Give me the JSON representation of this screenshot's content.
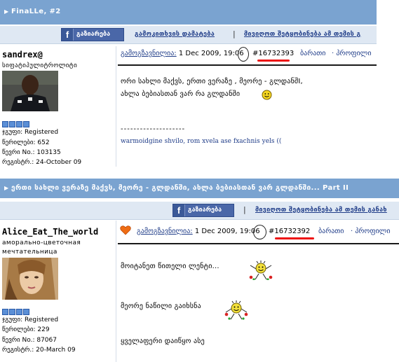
{
  "post1": {
    "thread_title": "FinaLLe, #2",
    "share_label": "გაზიარება",
    "add_link": "გამოკითხვის დამატება",
    "subscribe_link": "მივიღოთ შეტყობინება ამ თემის გ",
    "username": "sandrex@",
    "user_title": "სიფატიპულიტროლიტი",
    "group_label": "ჯგუფი: Registered",
    "posts_label": "წერილები: 652",
    "member_no": "წევრი No.: 103135",
    "registered": "რეგისტრ.: 24-October 09",
    "post_type": "გამოგზავნილია:",
    "date": "1 Dec 2009, 19:06",
    "post_id": "#16732393",
    "reply_link": "ბარათი",
    "profile_link": "· პროფილი",
    "message_line1": "ორი სახლი მაქვს, ერთი ვერაზე , მეორე - გლდანშI,",
    "message_line2": "ახლა ბებიასთან ვარ რა გლდანში",
    "separator": "--------------------",
    "signature": "warmoidgine shvilo, rom xvela ase fxachnis yels (("
  },
  "post2": {
    "thread_title": "ერთი სახლი ვერაზე მაქვს, მეორე - გლდანში, ახლა ბებიასთან ვარ გლდანში... Part II",
    "share_label": "გაზიარება",
    "subscribe_link": "მივიღოთ შეტყობინება ამ თემის განახ",
    "username": "Alice_Eat_The_world",
    "user_title_line1": "аморально-цветочная",
    "user_title_line2": "мечтательница",
    "group_label": "ჯგუფი: Registered",
    "posts_label": "წერილები: 229",
    "member_no": "წევრი No.: 87067",
    "registered": "რეგისტრ.: 20-March 09",
    "post_type": "გამოგზავნილია:",
    "date": "1 Dec 2009, 19:06",
    "post_id": "#16732392",
    "reply_link": "ბარათი",
    "profile_link": "· პროფილი",
    "message_line1": "მოიტანეთ წითელი ლენტი...",
    "message_line2": "მეორე ნაწილი გაიხსნა",
    "message_line3": "ყველაფერი დაიწყო ასე"
  },
  "colors": {
    "header_blue": "#7aa3d0",
    "toolbar_bg": "#dfe8f3",
    "link_blue": "#1f3c88",
    "highlight_red": "#e11111",
    "facebook_blue": "#3b5998"
  }
}
